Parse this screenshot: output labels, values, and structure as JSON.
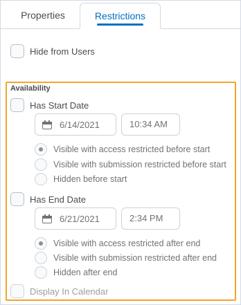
{
  "tabs": [
    {
      "label": "Properties"
    },
    {
      "label": "Restrictions"
    }
  ],
  "hide_from_users": {
    "label": "Hide from Users"
  },
  "availability": {
    "label": "Availability",
    "start": {
      "checkbox_label": "Has Start Date",
      "date": "6/14/2021",
      "time": "10:34 AM",
      "options": [
        "Visible with access restricted before start",
        "Visible with submission restricted before start",
        "Hidden before start"
      ]
    },
    "end": {
      "checkbox_label": "Has End Date",
      "date": "6/21/2021",
      "time": "2:34 PM",
      "options": [
        "Visible with access restricted after end",
        "Visible with submission restricted after end",
        "Hidden after end"
      ]
    },
    "display_in_calendar": "Display In Calendar"
  },
  "colors": {
    "accent": "#006fbf",
    "highlight_border": "#f3a42b"
  }
}
